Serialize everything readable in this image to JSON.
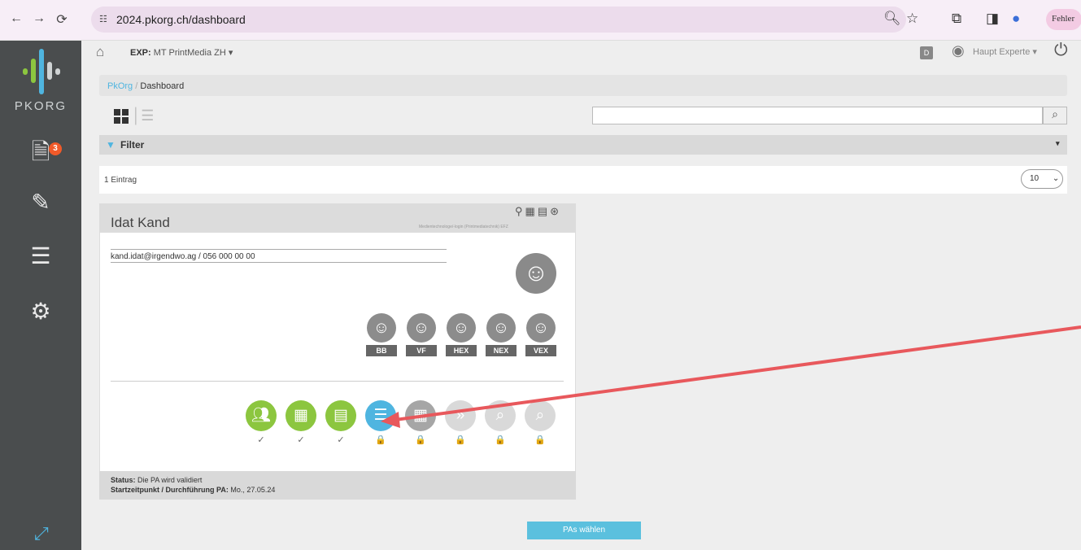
{
  "browser": {
    "url": "2024.pkorg.ch/dashboard",
    "profile_label": "Fehler",
    "nav_icons": [
      "back-icon",
      "forward-icon",
      "reload-icon"
    ],
    "toolbar_icons": [
      "zoom-icon",
      "star-icon",
      "extensions-icon",
      "sidepanel-icon",
      "profile-icon"
    ]
  },
  "sidebar": {
    "logo_text": "PKORG",
    "badge_count": "3",
    "items": [
      "documents-icon",
      "edit-icon",
      "list-icon",
      "settings-icon"
    ],
    "expand_icon": "expand-icon"
  },
  "topbar": {
    "exp_label": "EXP:",
    "exp_value": "MT PrintMedia ZH",
    "d_label": "D",
    "user": "Haupt Experte"
  },
  "breadcrumb": {
    "root": "PkOrg",
    "sep": "/",
    "current": "Dashboard"
  },
  "search": {
    "placeholder": ""
  },
  "filter": {
    "label": "Filter"
  },
  "list": {
    "count_text": "1 Eintrag",
    "per_page": "10"
  },
  "card": {
    "name": "Idat Kand",
    "subtitle": "Medientechnologe/-login (Printmediatechnik) EFZ",
    "contact": "kand.idat@irgendwo.ag / 056 000 00 00",
    "roles": [
      "BB",
      "VF",
      "HEX",
      "NEX",
      "VEX"
    ],
    "steps": [
      {
        "icon": "people-icon",
        "color": "#8cc63f",
        "check": "✓"
      },
      {
        "icon": "calendar-icon",
        "color": "#8cc63f",
        "check": "✓"
      },
      {
        "icon": "document-icon",
        "color": "#8cc63f",
        "check": "✓"
      },
      {
        "icon": "list-icon",
        "color": "#4fb5e0",
        "check": "🔒"
      },
      {
        "icon": "calendar-icon",
        "color": "#a6a6a6",
        "check": "🔒"
      },
      {
        "icon": "forward-icon",
        "color": "#d9d9d9",
        "check": "🔒"
      },
      {
        "icon": "review-icon",
        "color": "#d9d9d9",
        "check": "🔒"
      },
      {
        "icon": "review-icon",
        "color": "#d9d9d9",
        "check": "🔒"
      }
    ],
    "status_label": "Status:",
    "status_value": "Die PA wird validiert",
    "start_label": "Startzeitpunkt / Durchführung PA:",
    "start_value": "Mo., 27.05.24"
  },
  "action": {
    "button_label": "PAs wählen"
  },
  "annotation": {
    "arrow_color": "#e8585c"
  }
}
